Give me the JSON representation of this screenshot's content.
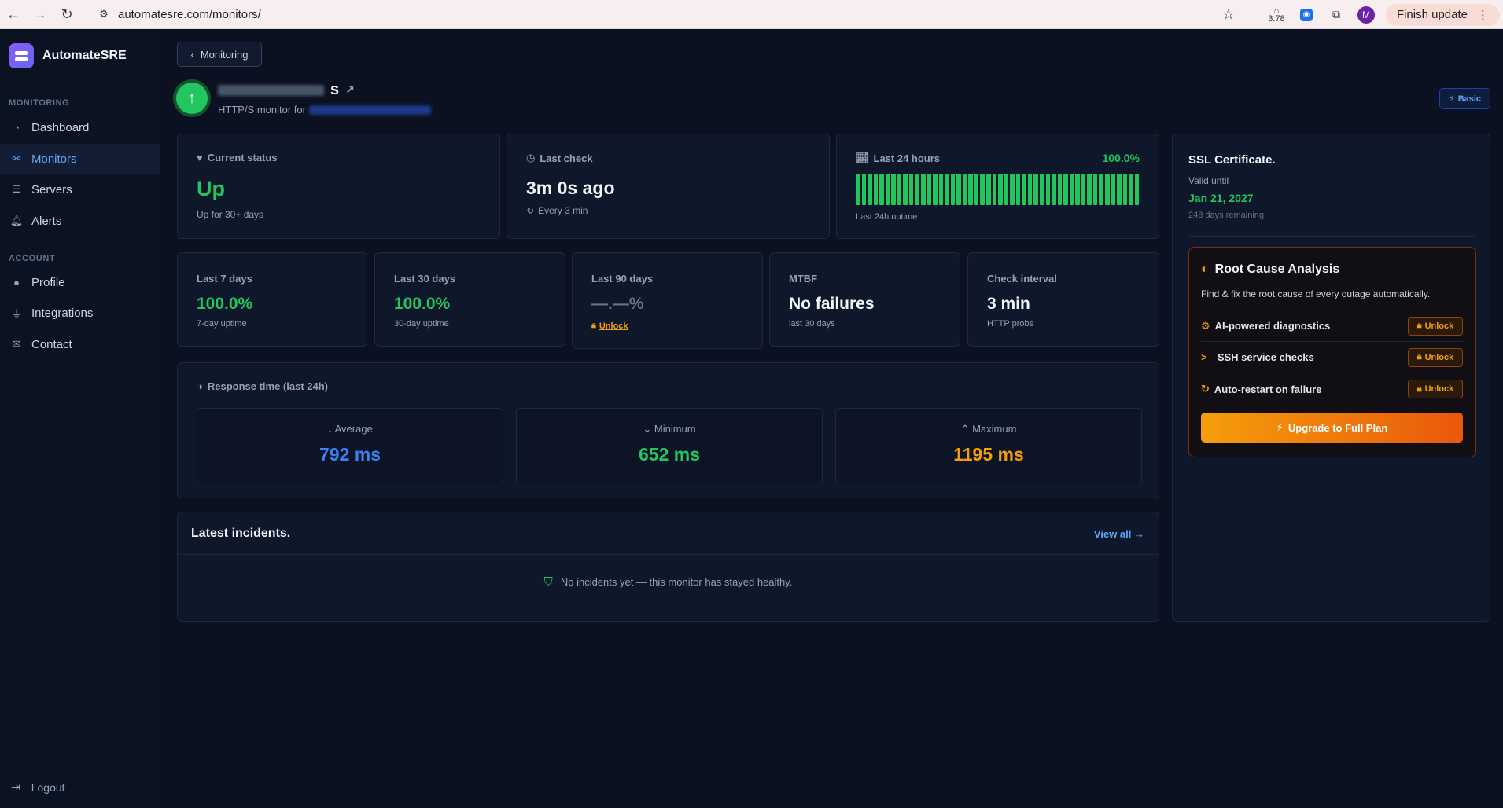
{
  "browser": {
    "url": "automatesre.com/monitors/",
    "extension_count": "3.78",
    "profile_initial": "M",
    "update_label": "Finish update"
  },
  "sidebar": {
    "brand": "AutomateSRE",
    "monitoring_label": "MONITORING",
    "account_label": "ACCOUNT",
    "monitoring_items": [
      {
        "label": "Dashboard",
        "icon": "gauge-icon"
      },
      {
        "label": "Monitors",
        "icon": "signal-icon"
      },
      {
        "label": "Servers",
        "icon": "server-icon"
      },
      {
        "label": "Alerts",
        "icon": "bell-icon"
      }
    ],
    "account_items": [
      {
        "label": "Profile",
        "icon": "user-icon"
      },
      {
        "label": "Integrations",
        "icon": "plug-icon"
      },
      {
        "label": "Contact",
        "icon": "mail-icon"
      }
    ],
    "logout": "Logout"
  },
  "header": {
    "back_label": "Monitoring",
    "title_visible_end": "s",
    "subtitle": "HTTP/S monitor for",
    "plan": "Basic"
  },
  "status_card": {
    "label": "Current status",
    "value": "Up",
    "note": "Up for 30+ days"
  },
  "last_check_card": {
    "label": "Last check",
    "value": "3m 0s ago",
    "note": "Every 3 min"
  },
  "last24_card": {
    "label": "Last 24 hours",
    "percent": "100.0%",
    "note": "Last 24h uptime",
    "bar_count": 48
  },
  "stats": [
    {
      "label": "Last 7 days",
      "value": "100.0%",
      "sub": "7-day uptime",
      "color": "#22c55e"
    },
    {
      "label": "Last 30 days",
      "value": "100.0%",
      "sub": "30-day uptime",
      "color": "#22c55e"
    },
    {
      "label": "Last 90 days",
      "value": "—.—%",
      "sub": "Unlock",
      "color": "#64748b"
    },
    {
      "label": "MTBF",
      "value": "No failures",
      "sub": "last 30 days",
      "color": "#f1f5f9"
    },
    {
      "label": "Check interval",
      "value": "3 min",
      "sub": "HTTP probe",
      "color": "#f1f5f9"
    }
  ],
  "response_time": {
    "label": "Response time (last 24h)",
    "average_label": "Average",
    "average": "792 ms",
    "minimum_label": "Minimum",
    "minimum": "652 ms",
    "maximum_label": "Maximum",
    "maximum": "1195 ms",
    "colors": {
      "average": "#3b82f6",
      "minimum": "#22c55e",
      "maximum": "#f59e0b"
    }
  },
  "incidents": {
    "title": "Latest incidents.",
    "view_all": "View all →",
    "empty": "No incidents yet — this monitor has stayed healthy."
  },
  "ssl": {
    "title": "SSL Certificate.",
    "valid_label": "Valid until",
    "date": "Jan 21, 2027",
    "remaining": "248 days remaining"
  },
  "rca": {
    "title": "Root Cause Analysis",
    "description": "Find & fix the root cause of every outage automatically.",
    "features": [
      {
        "label": "AI-powered diagnostics",
        "icon": "robot-icon",
        "action": "Unlock"
      },
      {
        "label": "SSH service checks",
        "icon": "terminal-icon",
        "action": "Unlock"
      },
      {
        "label": "Auto-restart on failure",
        "icon": "restart-icon",
        "action": "Unlock"
      }
    ],
    "upgrade": "Upgrade to Full Plan"
  }
}
